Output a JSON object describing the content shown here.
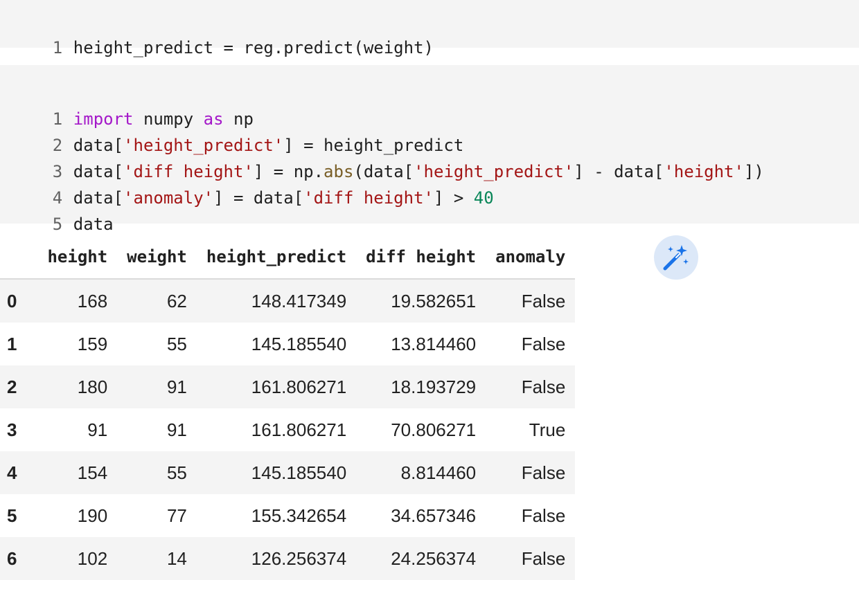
{
  "cell1": {
    "line_numbers": [
      "1"
    ],
    "line1": "height_predict = reg.predict(weight)"
  },
  "cell2": {
    "line_numbers": [
      "1",
      "2",
      "3",
      "4",
      "5"
    ],
    "l1": {
      "a": "import",
      "b": " numpy ",
      "c": "as",
      "d": " np"
    },
    "l2": {
      "a": "data[",
      "b": "'height_predict'",
      "c": "] = height_predict"
    },
    "l3": {
      "a": "data[",
      "b": "'diff height'",
      "c": "] = np.",
      "d": "abs",
      "e": "(data[",
      "f": "'height_predict'",
      "g": "] - data[",
      "h": "'height'",
      "i": "])"
    },
    "l4": {
      "a": "data[",
      "b": "'anomaly'",
      "c": "] = data[",
      "d": "'diff height'",
      "e": "] > ",
      "f": "40"
    },
    "l5": {
      "a": "data"
    }
  },
  "table": {
    "columns": [
      "height",
      "weight",
      "height_predict",
      "diff height",
      "anomaly"
    ],
    "rows": [
      {
        "idx": "0",
        "cells": [
          "168",
          "62",
          "148.417349",
          "19.582651",
          "False"
        ]
      },
      {
        "idx": "1",
        "cells": [
          "159",
          "55",
          "145.185540",
          "13.814460",
          "False"
        ]
      },
      {
        "idx": "2",
        "cells": [
          "180",
          "91",
          "161.806271",
          "18.193729",
          "False"
        ]
      },
      {
        "idx": "3",
        "cells": [
          "91",
          "91",
          "161.806271",
          "70.806271",
          "True"
        ]
      },
      {
        "idx": "4",
        "cells": [
          "154",
          "55",
          "145.185540",
          "8.814460",
          "False"
        ]
      },
      {
        "idx": "5",
        "cells": [
          "190",
          "77",
          "155.342654",
          "34.657346",
          "False"
        ]
      },
      {
        "idx": "6",
        "cells": [
          "102",
          "14",
          "126.256374",
          "24.256374",
          "False"
        ]
      }
    ]
  },
  "icons": {
    "magic_button": "magic-wand-icon"
  },
  "colors": {
    "keyword": "#a418c9",
    "string": "#a31515",
    "function": "#795e26",
    "number": "#098658",
    "cell_bg": "#f4f4f4",
    "magic_bg": "#dce8f8",
    "magic_icon": "#1a73e8"
  }
}
